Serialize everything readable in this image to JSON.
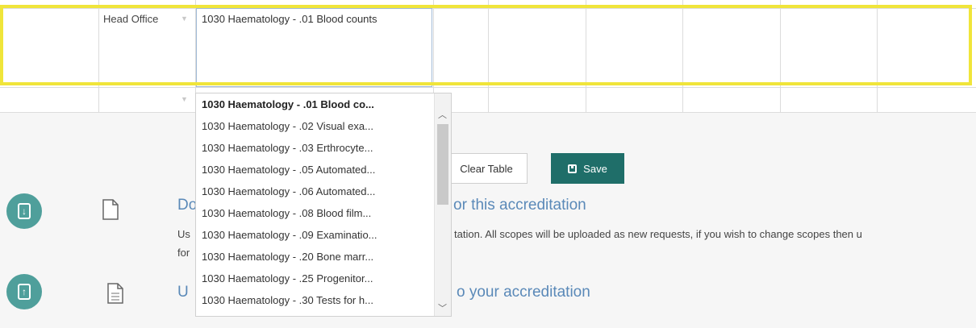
{
  "table": {
    "office": "Head Office",
    "scope_value": "1030 Haematology - .01 Blood counts"
  },
  "dropdown": {
    "items": [
      "1030 Haematology - .01 Blood co...",
      "1030 Haematology - .02 Visual exa...",
      "1030 Haematology - .03 Erthrocyte...",
      "1030 Haematology - .05 Automated...",
      "1030 Haematology - .06 Automated...",
      "1030 Haematology - .08 Blood film...",
      "1030 Haematology - .09 Examinatio...",
      "1030 Haematology - .20 Bone marr...",
      "1030 Haematology - .25 Progenitor...",
      "1030 Haematology - .30 Tests for h..."
    ],
    "selected_index": 0
  },
  "buttons": {
    "clear": "Clear Table",
    "save": "Save"
  },
  "download": {
    "heading_start": "Do",
    "heading_end": "or this accreditation",
    "line1_start": "Us",
    "line1_end": "tation. All scopes will be uploaded as new requests, if you wish to change scopes then u",
    "line2_start": "for"
  },
  "upload": {
    "heading_start": "U",
    "heading_end": "o your accreditation"
  },
  "colors": {
    "highlight": "#f0e53a",
    "save_bg": "#1f6e69",
    "circle_icon": "#4f9f9b",
    "link": "#5a89b8"
  },
  "icons": [
    "download-icon",
    "upload-icon",
    "file-icon",
    "document-icon",
    "save-disk-icon",
    "chevron-up-icon",
    "chevron-down-icon"
  ]
}
